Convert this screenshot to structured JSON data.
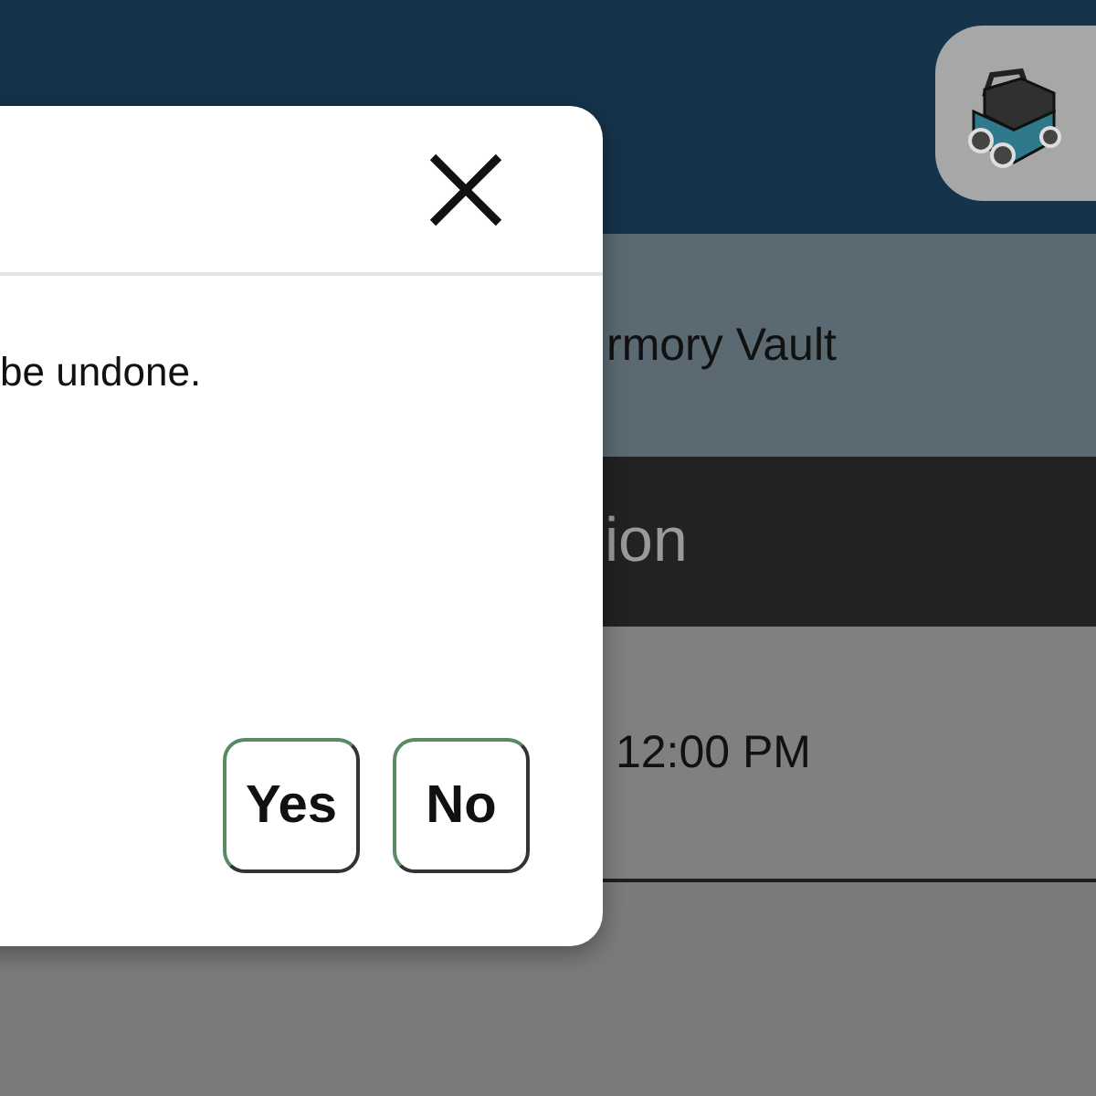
{
  "rows": [
    {
      "kind": "location",
      "text": "rmory Vault"
    },
    {
      "kind": "heading",
      "text": "ion"
    },
    {
      "kind": "time",
      "text": "12:00 PM"
    }
  ],
  "dialog": {
    "message": "be undone.",
    "buttons": [
      "Yes",
      "No"
    ]
  }
}
